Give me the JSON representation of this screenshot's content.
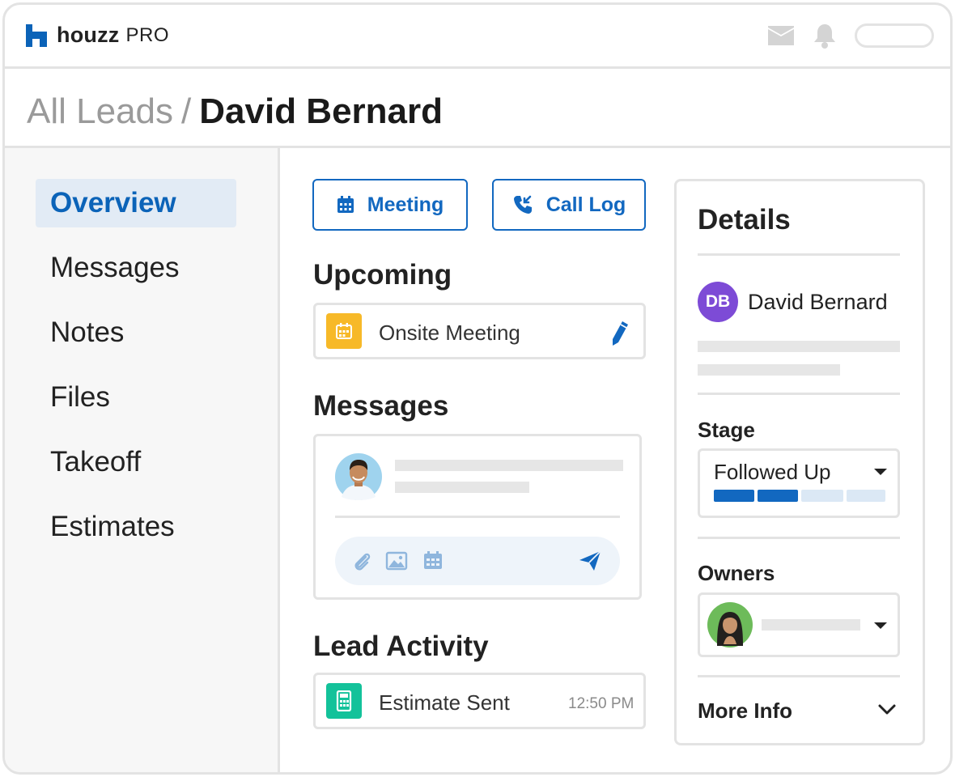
{
  "brand": {
    "name": "houzz",
    "suffix": "PRO"
  },
  "breadcrumb": {
    "parent": "All Leads",
    "separator": "/",
    "current": "David Bernard"
  },
  "sidebar": {
    "items": [
      {
        "label": "Overview",
        "active": true
      },
      {
        "label": "Messages",
        "active": false
      },
      {
        "label": "Notes",
        "active": false
      },
      {
        "label": "Files",
        "active": false
      },
      {
        "label": "Takeoff",
        "active": false
      },
      {
        "label": "Estimates",
        "active": false
      }
    ]
  },
  "actions": {
    "meeting_label": "Meeting",
    "call_log_label": "Call Log"
  },
  "upcoming": {
    "title": "Upcoming",
    "item_label": "Onsite Meeting"
  },
  "messages": {
    "title": "Messages"
  },
  "lead_activity": {
    "title": "Lead Activity",
    "item_label": "Estimate Sent",
    "time": "12:50 PM"
  },
  "details": {
    "title": "Details",
    "contact_initials": "DB",
    "contact_name": "David Bernard",
    "stage_label": "Stage",
    "stage_value": "Followed Up",
    "stage_progress": {
      "completed": 2,
      "total": 4
    },
    "owners_label": "Owners",
    "more_info_label": "More Info"
  },
  "colors": {
    "accent": "#1268c0",
    "brand": "#0b63b8",
    "meeting_icon_bg": "#f7b928",
    "estimate_icon_bg": "#13c29a",
    "avatar_bg": "#7d4bd6"
  }
}
